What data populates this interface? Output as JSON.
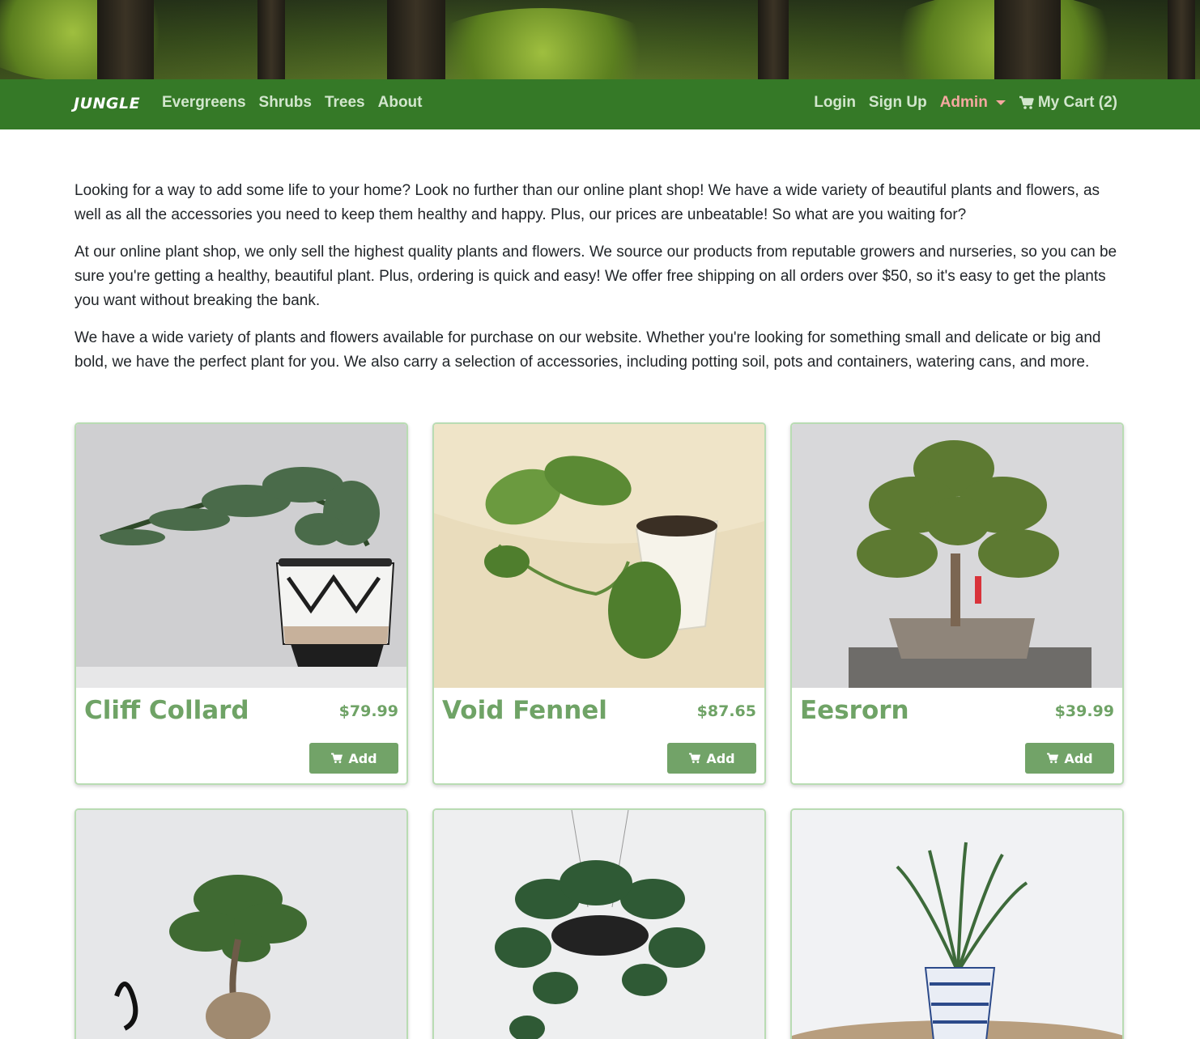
{
  "navbar": {
    "brand": "JUNGLE",
    "left_links": [
      "Evergreens",
      "Shrubs",
      "Trees",
      "About"
    ],
    "login": "Login",
    "signup": "Sign Up",
    "admin": "Admin",
    "cart": "My Cart (2)"
  },
  "intro": {
    "paragraphs": [
      "Looking for a way to add some life to your home? Look no further than our online plant shop! We have a wide variety of beautiful plants and flowers, as well as all the accessories you need to keep them healthy and happy. Plus, our prices are unbeatable! So what are you waiting for?",
      "At our online plant shop, we only sell the highest quality plants and flowers. We source our products from reputable growers and nurseries, so you can be sure you're getting a healthy, beautiful plant. Plus, ordering is quick and easy! We offer free shipping on all orders over $50, so it's easy to get the plants you want without breaking the bank.",
      "We have a wide variety of plants and flowers available for purchase on our website. Whether you're looking for something small and delicate or big and bold, we have the perfect plant for you. We also carry a selection of accessories, including potting soil, pots and containers, watering cans, and more."
    ]
  },
  "products": [
    {
      "name": "Cliff Collard",
      "price": "$79.99",
      "button": "Add"
    },
    {
      "name": "Void Fennel",
      "price": "$87.65",
      "button": "Add"
    },
    {
      "name": "Eesrorn",
      "price": "$39.99",
      "button": "Add"
    }
  ],
  "colors": {
    "navbar": "#357927",
    "nav_link": "#d2e6cd",
    "admin_link": "#f6a8a0",
    "product_text": "#6fa366",
    "add_button": "#72a368",
    "card_border": "#b9dcb3"
  },
  "icons": {
    "cart": "shopping-cart-icon",
    "admin_toggle": "caret-down-icon"
  }
}
